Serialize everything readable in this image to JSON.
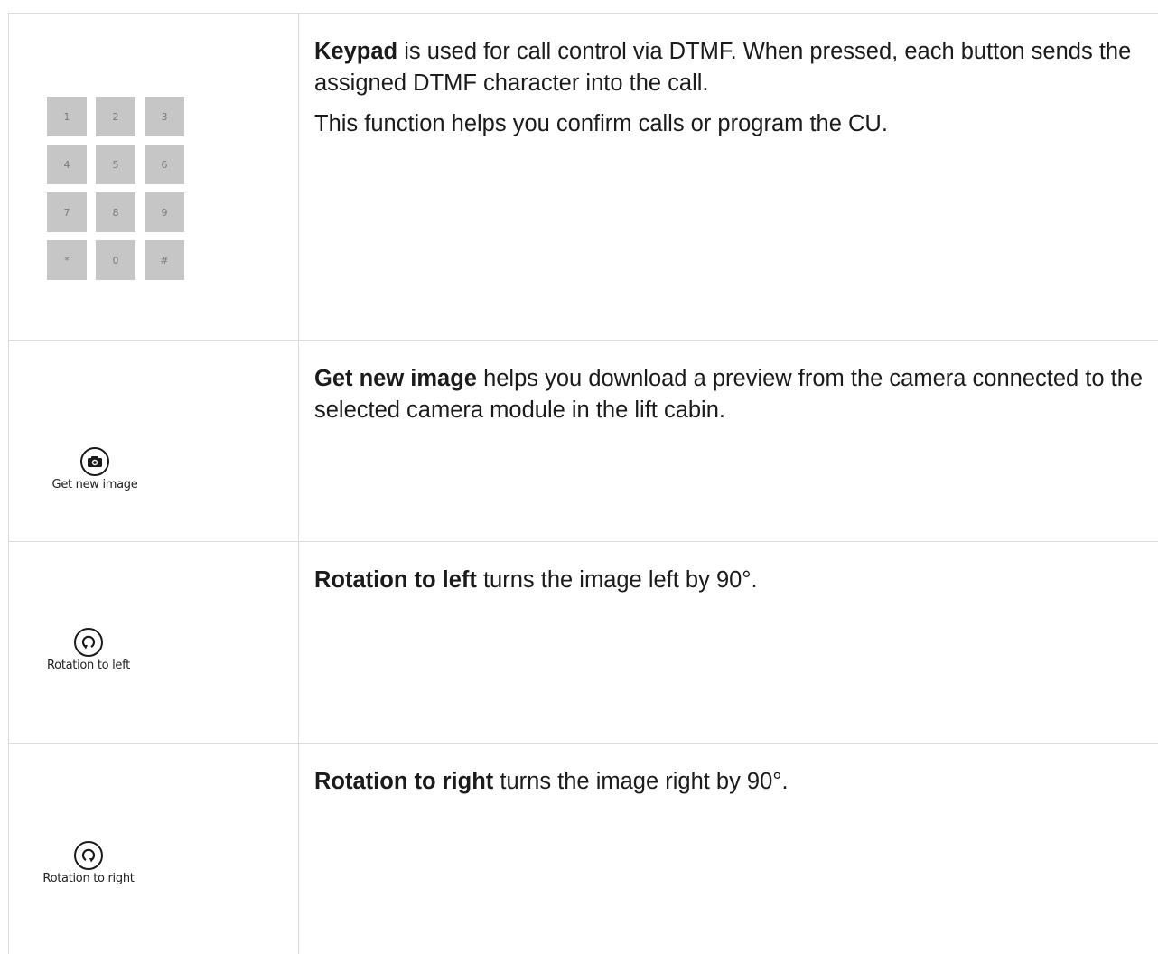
{
  "rows": [
    {
      "keypad": {
        "keys": [
          "1",
          "2",
          "3",
          "4",
          "5",
          "6",
          "7",
          "8",
          "9",
          "*",
          "0",
          "#"
        ]
      },
      "title": "Keypad",
      "text": " is used for call control via DTMF. When pressed, each button sends the assigned DTMF character into the call.",
      "text2": "This function helps you confirm calls or program the CU."
    },
    {
      "button_label": "Get new image",
      "icon": "camera-icon",
      "title": "Get new image",
      "text": " helps you download a preview from the camera connected to the selected camera module in the lift cabin."
    },
    {
      "button_label": "Rotation to left",
      "icon": "rotate-left-icon",
      "title": "Rotation to left",
      "text": " turns the image left by 90°."
    },
    {
      "button_label": "Rotation to right",
      "icon": "rotate-right-icon",
      "title": "Rotation to right",
      "text": " turns the image right by 90°."
    }
  ]
}
